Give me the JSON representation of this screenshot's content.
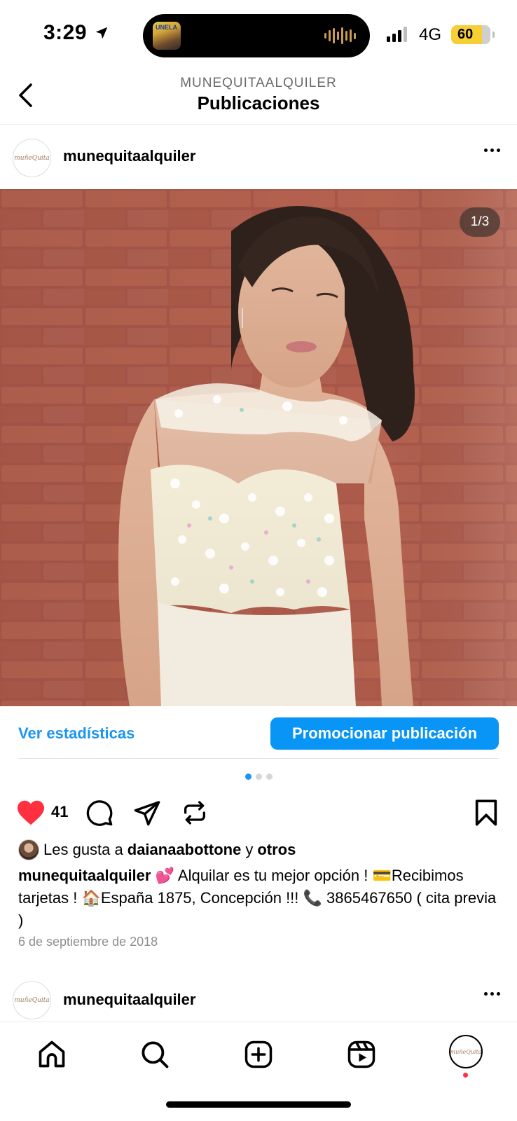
{
  "status_bar": {
    "time": "3:29",
    "network": "4G",
    "battery": "60",
    "island_art_text": "UNELA"
  },
  "header": {
    "subtitle": "MUNEQUITAALQUILER",
    "title": "Publicaciones"
  },
  "post": {
    "username": "munequitaalquiler",
    "avatar_text": "muñeQuita",
    "image_counter": "1/3",
    "stats_link": "Ver estadísticas",
    "promote_button": "Promocionar publicación",
    "carousel": {
      "total": 3,
      "active": 1
    },
    "like_count": "41",
    "likes": {
      "prefix": "Les gusta a",
      "user": "daianaabottone",
      "joiner": "y",
      "others": "otros"
    },
    "caption": {
      "user": "munequitaalquiler",
      "text": "💕 Alquilar es tu mejor opción ! 💳Recibimos tarjetas ! 🏠España 1875, Concepción !!! 📞 3865467650 ( cita previa )"
    },
    "date": "6 de septiembre de 2018"
  },
  "next_post": {
    "username": "munequitaalquiler",
    "avatar_text": "muñeQuita"
  },
  "tabbar": {
    "profile_text": "muñeQuita",
    "items": [
      "home-icon",
      "search-icon",
      "create-icon",
      "reels-icon",
      "profile-avatar"
    ]
  },
  "colors": {
    "accent": "#0895f6",
    "link": "#1b95f0",
    "like": "#ff3040",
    "battery": "#f6ce36"
  }
}
